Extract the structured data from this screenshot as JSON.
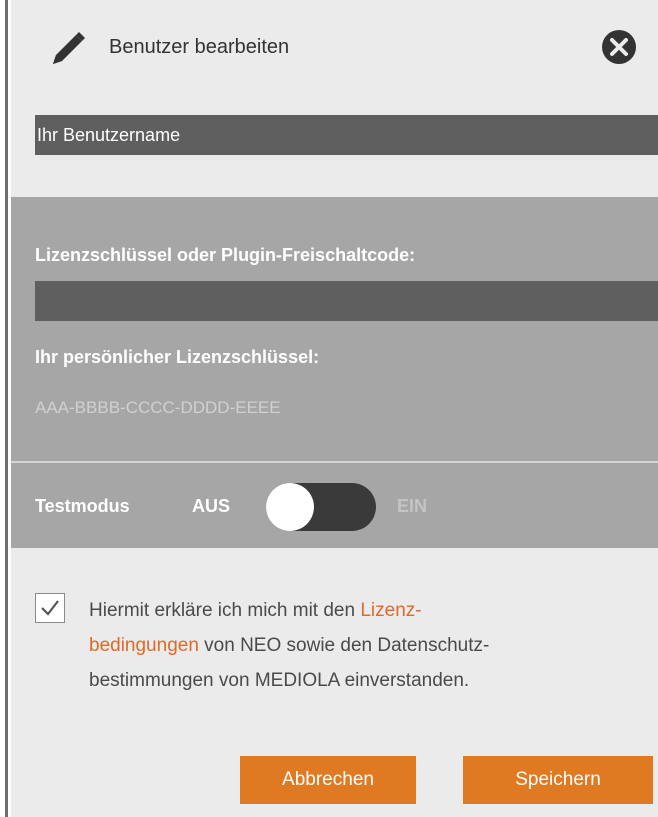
{
  "header": {
    "title": "Benutzer bearbeiten",
    "edit_icon": "pencil-icon",
    "close_icon": "close-icon"
  },
  "username": {
    "placeholder": "Ihr Benutzername",
    "value": ""
  },
  "license": {
    "label": "Lizenzschlüssel oder Plugin-Freischaltcode:",
    "input_value": "",
    "personal_label": "Ihr persönlicher Lizenzschlüssel:",
    "personal_key": "AAA-BBBB-CCCC-DDDD-EEEE"
  },
  "testmode": {
    "label": "Testmodus",
    "off_label": "AUS",
    "on_label": "EIN",
    "state": "off"
  },
  "consent": {
    "checked": true,
    "text_before": "Hiermit erkläre ich mich mit den ",
    "link_part1": "Lizenz-",
    "link_part2": "bedingungen",
    "text_after_line2": " von NEO sowie den Datenschutz-",
    "text_line3": "bestimmungen von MEDIOLA einverstanden."
  },
  "buttons": {
    "cancel_label": "Abbrechen",
    "save_label": "Speichern"
  },
  "colors": {
    "accent": "#e07a22",
    "link": "#e0692a",
    "panel_bg": "#ebebeb",
    "section_bg": "#a6a6a6",
    "input_bg": "#5f5f5f"
  }
}
